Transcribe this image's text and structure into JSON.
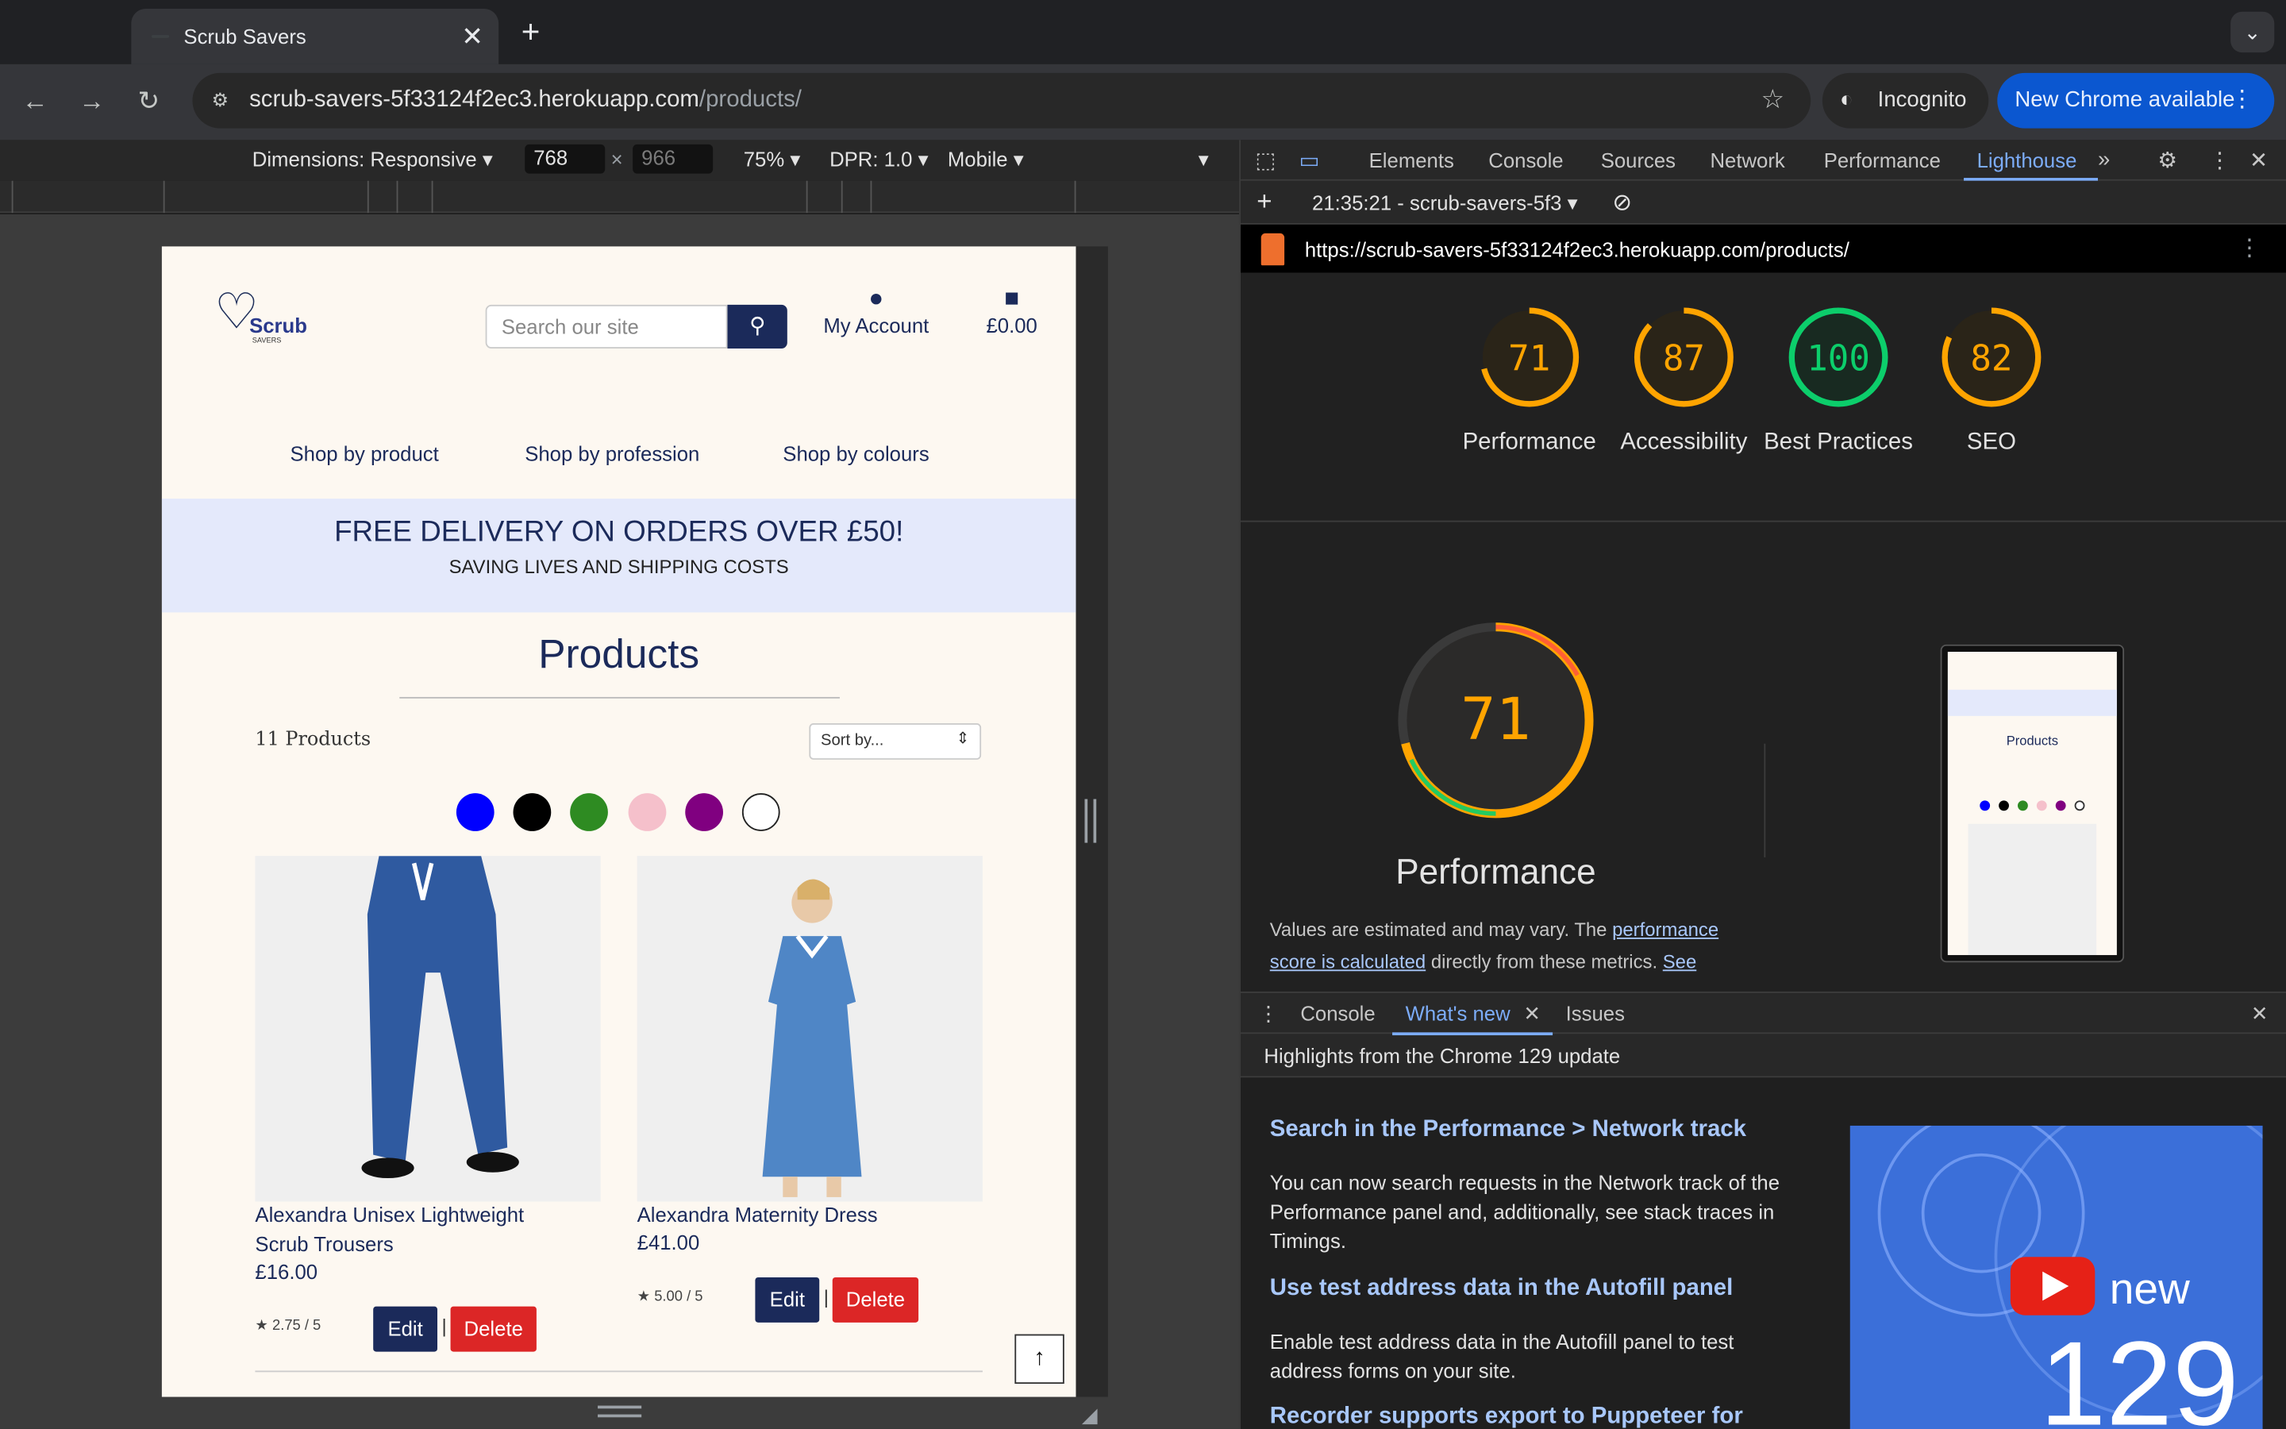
{
  "browser": {
    "tab_title": "Scrub Savers",
    "url_host": "scrub-savers-5f33124f2ec3.herokuapp.com",
    "url_path": "/products/",
    "incognito_label": "Incognito",
    "update_label": "New Chrome available"
  },
  "device_toolbar": {
    "dimensions": "Dimensions: Responsive",
    "width": "768",
    "height": "966",
    "zoom": "75%",
    "dpr": "DPR: 1.0",
    "mode": "Mobile"
  },
  "site": {
    "logo_text": "Scrub",
    "logo_sub": "SAVERS",
    "search_placeholder": "Search our site",
    "account_label": "My Account",
    "bag_total": "£0.00",
    "nav": [
      "Shop by product",
      "Shop by profession",
      "Shop by colours"
    ],
    "banner_title": "FREE DELIVERY ON ORDERS OVER £50!",
    "banner_sub": "SAVING LIVES AND SHIPPING COSTS",
    "page_title": "Products",
    "count": "11 Products",
    "sort_label": "Sort by...",
    "swatches": [
      "#0000ff",
      "#000000",
      "#2e8b22",
      "#f5c0cb",
      "#800080",
      "#ffffff"
    ],
    "products": [
      {
        "name_line1": "Alexandra Unisex Lightweight",
        "name_line2": "Scrub Trousers",
        "price": "£16.00",
        "rating": "2.75 / 5",
        "edit": "Edit",
        "delete": "Delete"
      },
      {
        "name_line1": "Alexandra Maternity Dress",
        "name_line2": "",
        "price": "£41.00",
        "rating": "5.00 / 5",
        "edit": "Edit",
        "delete": "Delete"
      }
    ]
  },
  "devtools": {
    "tabs": [
      "Elements",
      "Console",
      "Sources",
      "Network",
      "Performance",
      "Lighthouse"
    ],
    "active_tab": "Lighthouse",
    "report_label": "21:35:21 - scrub-savers-5f3",
    "report_url": "https://scrub-savers-5f33124f2ec3.herokuapp.com/products/",
    "scores": [
      {
        "value": "71",
        "label": "Performance",
        "color": "#ffa400",
        "fraction": 0.71
      },
      {
        "value": "87",
        "label": "Accessibility",
        "color": "#ffa400",
        "fraction": 0.87
      },
      {
        "value": "100",
        "label": "Best Practices",
        "color": "#0cce6b",
        "fraction": 1.0
      },
      {
        "value": "82",
        "label": "SEO",
        "color": "#ffa400",
        "fraction": 0.82
      }
    ],
    "big_score": "71",
    "big_label": "Performance",
    "note_pre": "Values are estimated and may vary. The ",
    "note_link1": "performance score is calculated",
    "note_mid": " directly from these metrics. ",
    "note_link2": "See",
    "thumb_title": "Products",
    "drawer_tabs": [
      "Console",
      "What's new",
      "Issues"
    ],
    "drawer_sub": "Highlights from the Chrome 129 update",
    "whatsnew": [
      {
        "title": "Search in the Performance > Network track",
        "body": "You can now search requests in the Network track of the Performance panel and, additionally, see stack traces in Timings."
      },
      {
        "title": "Use test address data in the Autofill panel",
        "body": "Enable test address data in the Autofill panel to test address forms on your site."
      },
      {
        "title": "Recorder supports export to Puppeteer for",
        "body": ""
      }
    ],
    "video_word": "new",
    "video_num": "129"
  }
}
